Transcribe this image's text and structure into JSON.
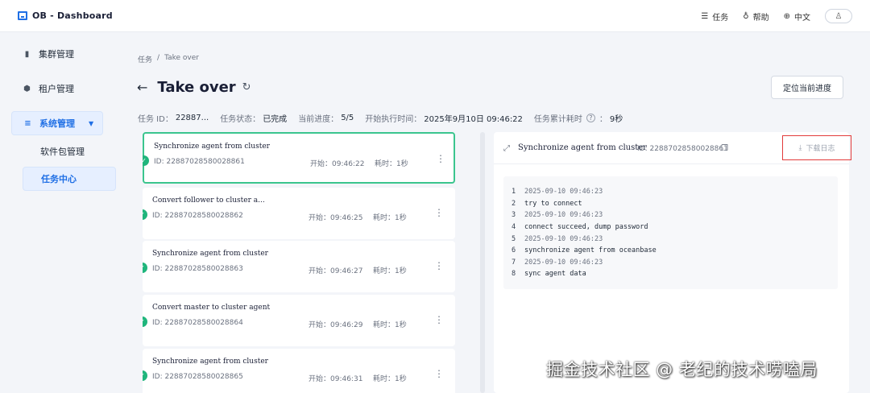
{
  "app": {
    "logo_text": "OB - Dashboard"
  },
  "topbar": {
    "tasks": "任务",
    "help": "帮助",
    "language": "中文",
    "user_icon": "person-icon"
  },
  "sidebar": {
    "items": [
      {
        "label": "集群管理",
        "icon": "bar-chart-icon"
      },
      {
        "label": "租户管理",
        "icon": "cube-icon"
      },
      {
        "label": "系统管理",
        "icon": "sliders-icon"
      }
    ],
    "sub_items": [
      {
        "label": "软件包管理"
      },
      {
        "label": "任务中心"
      }
    ]
  },
  "breadcrumb": {
    "parent": "任务",
    "separator": "/",
    "current": "Take over"
  },
  "header": {
    "title": "Take over",
    "locate_button": "定位当前进度"
  },
  "meta": {
    "id_label": "任务 ID：",
    "id_value": "22887...",
    "status_label": "任务状态：",
    "status_value": "已完成",
    "progress_label": "当前进度：",
    "progress_value": "5/5",
    "start_label": "开始执行时间：",
    "start_value": "2025年9月10日 09:46:22",
    "elapsed_label": "任务累计耗时",
    "elapsed_value": "9秒"
  },
  "tasks": [
    {
      "name": "Synchronize agent from cluster",
      "id": "ID: 22887028580028861",
      "start": "开始：09:46:22",
      "duration": "耗时：1秒",
      "selected": true
    },
    {
      "name": "Convert follower to cluster a...",
      "id": "ID: 22887028580028862",
      "start": "开始：09:46:25",
      "duration": "耗时：1秒",
      "selected": false
    },
    {
      "name": "Synchronize agent from cluster",
      "id": "ID: 22887028580028863",
      "start": "开始：09:46:27",
      "duration": "耗时：1秒",
      "selected": false
    },
    {
      "name": "Convert master to cluster agent",
      "id": "ID: 22887028580028864",
      "start": "开始：09:46:29",
      "duration": "耗时：1秒",
      "selected": false
    },
    {
      "name": "Synchronize agent from cluster",
      "id": "ID: 22887028580028865",
      "start": "开始：09:46:31",
      "duration": "耗时：1秒",
      "selected": false
    }
  ],
  "log": {
    "title": "Synchronize agent from cluster",
    "id": "ID: 22887028580028861",
    "download": "下载日志",
    "lines": [
      {
        "n": "1",
        "text": "2025-09-10 09:46:23",
        "kind": "time"
      },
      {
        "n": "2",
        "text": " try to connect",
        "kind": "msg"
      },
      {
        "n": "3",
        "text": "2025-09-10 09:46:23",
        "kind": "time"
      },
      {
        "n": "4",
        "text": " connect succeed, dump password",
        "kind": "msg"
      },
      {
        "n": "5",
        "text": "2025-09-10 09:46:23",
        "kind": "time"
      },
      {
        "n": "6",
        "text": " synchronize agent from oceanbase",
        "kind": "msg"
      },
      {
        "n": "7",
        "text": "2025-09-10 09:46:23",
        "kind": "time"
      },
      {
        "n": "8",
        "text": " sync agent data",
        "kind": "msg"
      }
    ]
  },
  "watermark": "掘金技术社区 @ 老纪的技术唠嗑局"
}
